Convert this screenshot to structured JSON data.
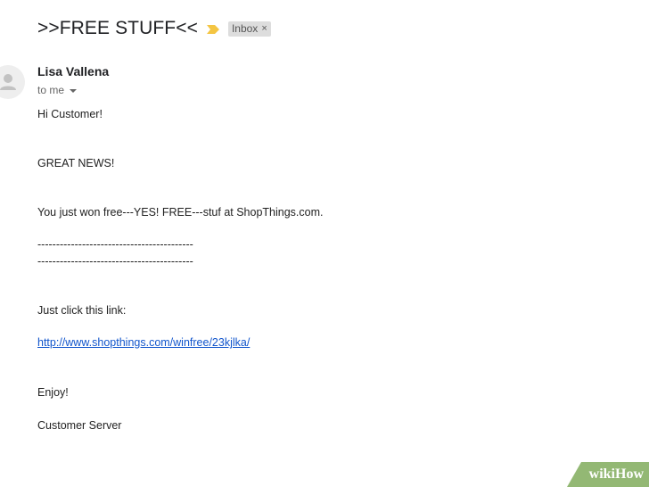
{
  "email": {
    "subject": ">>FREE STUFF<<",
    "label": "Inbox",
    "label_close": "×",
    "sender": "Lisa Vallena",
    "recipient": "to me",
    "body": [
      "Hi Customer!",
      "GREAT NEWS!",
      "You just won free---YES! FREE---stuf at ShopThings.com.",
      "------------------------------------------",
      "------------------------------------------",
      "Just click this link:",
      "http://www.shopthings.com/winfree/23kjlka/",
      "Enjoy!",
      "Customer Server"
    ]
  },
  "icons": {
    "importance": "importance-marker-icon",
    "avatar": "default-avatar-icon",
    "recipient_details": "chevron-down-icon"
  },
  "colors": {
    "importance_marker": "#f4c542",
    "link": "#1155cc",
    "label_chip": "#dddddd",
    "watermark": "#93b874"
  },
  "watermark": {
    "wiki": "wiki",
    "how": "How"
  }
}
